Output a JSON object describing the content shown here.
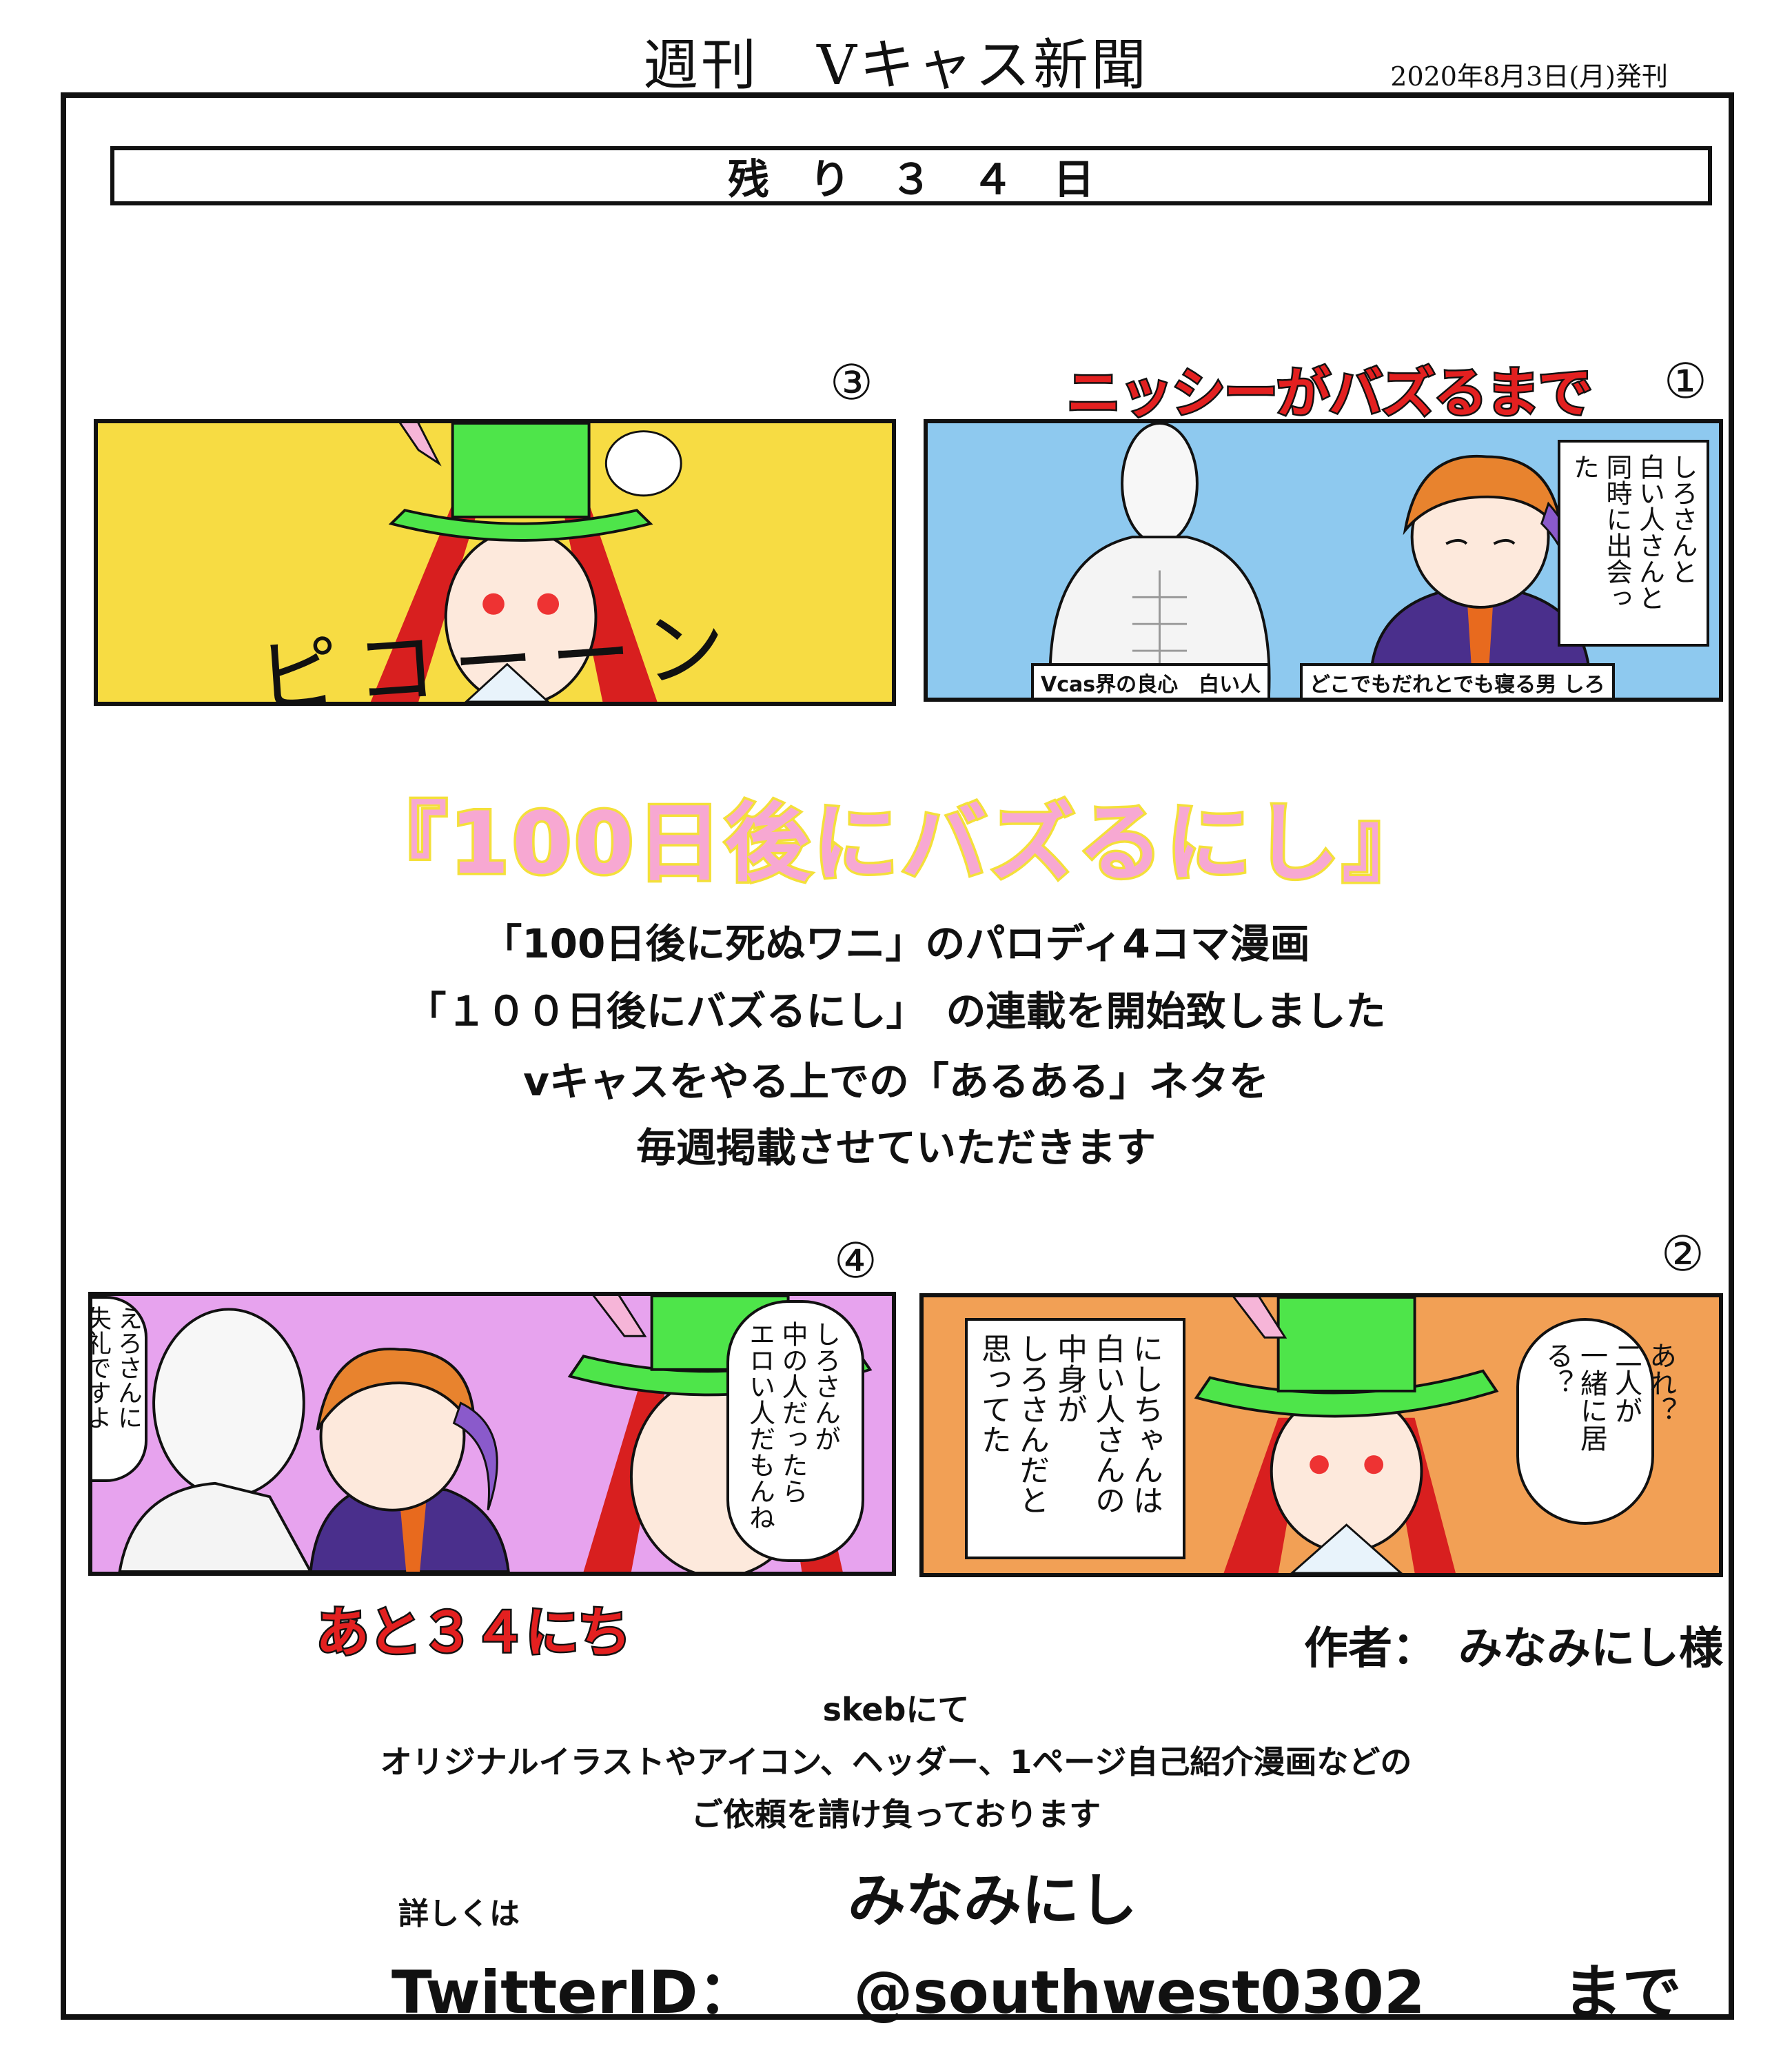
{
  "header": {
    "masthead": "週刊　Vキャス新聞",
    "issue_date": "2020年8月3日(月)発刊"
  },
  "countdown": {
    "text": "残り３４日"
  },
  "comic": {
    "title_top": "ニッシーがバズるまで",
    "title_bottom": "あと３４にち",
    "panel_1": {
      "number": "①",
      "caption": [
        "しろさんと",
        "白い人さんと",
        "同時に出会った"
      ],
      "tag_left": "Vcas界の良心　白い人",
      "tag_right": "どこでもだれとでも寝る男 しろ",
      "background": "#8ec9ef"
    },
    "panel_2": {
      "number": "②",
      "caption": [
        "にしちゃんは",
        "白い人さんの",
        "中身が",
        "しろさんだと",
        "思ってた"
      ],
      "speech": [
        "あれ？",
        "二人が",
        "一緒に居る？"
      ],
      "background": "#f2a055"
    },
    "panel_3": {
      "number": "③",
      "sfx": "ピコーーン",
      "background": "#f7dc43"
    },
    "panel_4": {
      "number": "④",
      "speech_left": [
        "えろさんに",
        "失礼ですよ"
      ],
      "speech_right": [
        "しろさんが",
        "中の人だったら",
        "エロい人だもんね"
      ],
      "background": "#e7a3ee"
    }
  },
  "announcement": {
    "series_title": "『100日後にバズるにし』",
    "line_1": "「100日後に死ぬワニ」のパロディ4コマ漫画",
    "line_2": "「１００日後にバズるにし」　の連載を開始致しました",
    "line_3": "vキャスをやる上での「あるある」ネタを",
    "line_4": "毎週掲載させていただきます"
  },
  "footer": {
    "author": "作者：　みなみにし様",
    "skeb_1": "skebにて",
    "skeb_2": "オリジナルイラストやアイコン、ヘッダー、1ページ自己紹介漫画などの",
    "skeb_3": "ご依頼を請け負っております",
    "details_label": "詳しくは",
    "artist_name": "みなみにし",
    "twitter_label": "TwitterID：",
    "twitter_handle": "@southwest0302",
    "twitter_suffix": "まで"
  }
}
